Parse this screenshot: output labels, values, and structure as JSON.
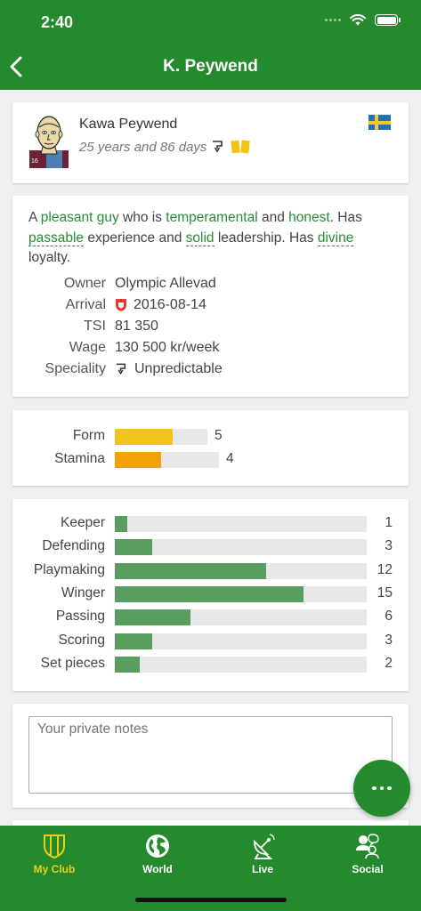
{
  "status": {
    "time": "2:40"
  },
  "nav": {
    "title": "K. Peywend"
  },
  "player": {
    "name": "Kawa Peywend",
    "age": "25 years and 86 days",
    "nationality_flag": "sweden-flag"
  },
  "description": {
    "a": "A ",
    "b": "pleasant guy",
    "c": " who is ",
    "d": "temperamental",
    "e": " and ",
    "f": "honest",
    "g": ". Has ",
    "h": "passable",
    "i": " experience and ",
    "j": "solid",
    "k": " leadership. Has ",
    "l": "divine",
    "m": " loyalty."
  },
  "info": {
    "owner_label": "Owner",
    "owner": "Olympic Allevad",
    "arrival_label": "Arrival",
    "arrival": "2016-08-14",
    "tsi_label": "TSI",
    "tsi": "81 350",
    "wage_label": "Wage",
    "wage": "130 500 kr/week",
    "speciality_label": "Speciality",
    "speciality": "Unpredictable"
  },
  "condition": [
    {
      "label": "Form",
      "value": "5",
      "level": 5,
      "max": 8,
      "color": "#f0c419"
    },
    {
      "label": "Stamina",
      "value": "4",
      "level": 4,
      "max": 9,
      "color": "#f5a10b"
    }
  ],
  "skills": [
    {
      "label": "Keeper",
      "value": "1",
      "level": 1
    },
    {
      "label": "Defending",
      "value": "3",
      "level": 3
    },
    {
      "label": "Playmaking",
      "value": "12",
      "level": 12
    },
    {
      "label": "Winger",
      "value": "15",
      "level": 15
    },
    {
      "label": "Passing",
      "value": "6",
      "level": 6
    },
    {
      "label": "Scoring",
      "value": "3",
      "level": 3
    },
    {
      "label": "Set pieces",
      "value": "2",
      "level": 2
    }
  ],
  "skill_color": "#5a9e5f",
  "notes": {
    "placeholder": "Your private notes"
  },
  "tabs": [
    {
      "label": "My Club",
      "icon": "shield-icon",
      "active": true
    },
    {
      "label": "World",
      "icon": "globe-icon",
      "active": false
    },
    {
      "label": "Live",
      "icon": "satellite-dish-icon",
      "active": false
    },
    {
      "label": "Social",
      "icon": "people-icon",
      "active": false
    }
  ],
  "colors": {
    "primary": "#248a2d",
    "accent": "#f2cc14"
  }
}
